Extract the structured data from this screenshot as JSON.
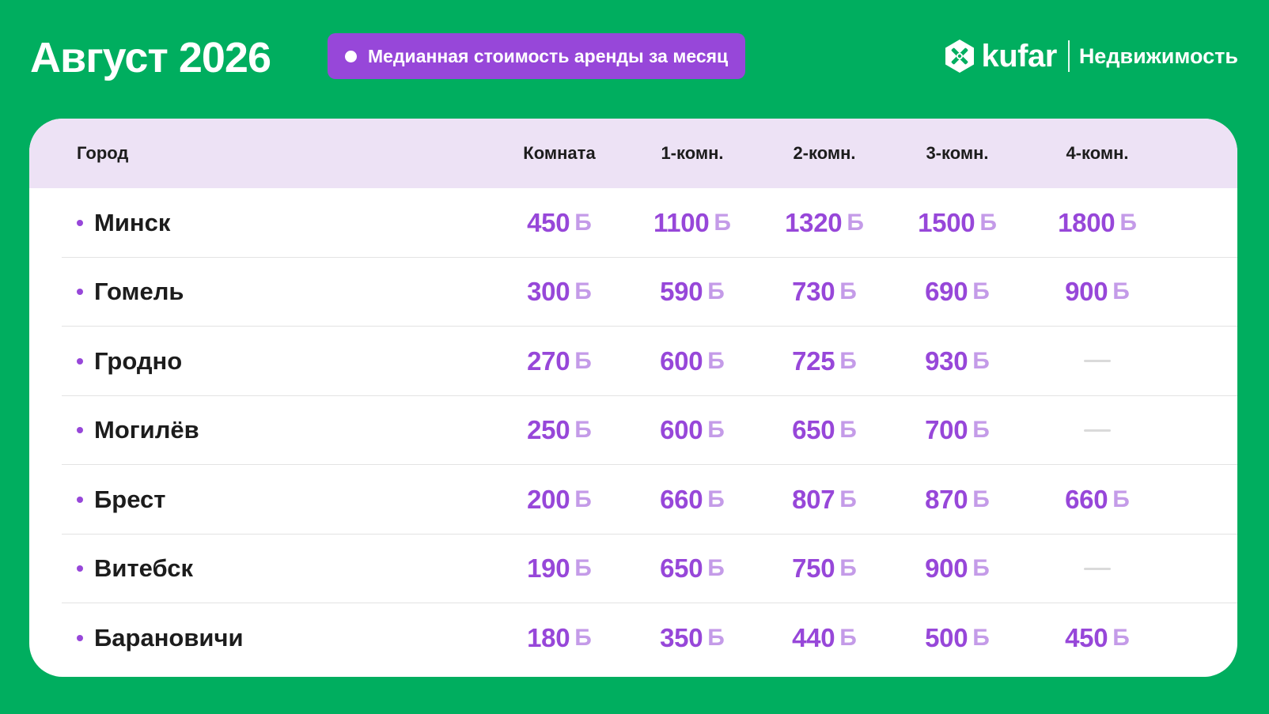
{
  "header": {
    "title": "Август 2026",
    "subtitle": "Медианная стоимость аренды за месяц",
    "brand_name": "kufar",
    "brand_section": "Недвижимость",
    "logo_icon": "kufar-hexagon-logo-icon"
  },
  "colors": {
    "background": "#00AE5F",
    "accent": "#9747D9",
    "accent_light": "#C49BE8",
    "header_row": "#EDE2F5",
    "text": "#1C1C1C"
  },
  "table": {
    "currency": "Б",
    "headers": [
      "Город",
      "Комната",
      "1-комн.",
      "2-комн.",
      "3-комн.",
      "4-комн."
    ],
    "rows": [
      {
        "city": "Минск",
        "values": [
          "450",
          "1100",
          "1320",
          "1500",
          "1800"
        ]
      },
      {
        "city": "Гомель",
        "values": [
          "300",
          "590",
          "730",
          "690",
          "900"
        ]
      },
      {
        "city": "Гродно",
        "values": [
          "270",
          "600",
          "725",
          "930",
          null
        ]
      },
      {
        "city": "Могилёв",
        "values": [
          "250",
          "600",
          "650",
          "700",
          null
        ]
      },
      {
        "city": "Брест",
        "values": [
          "200",
          "660",
          "807",
          "870",
          "660"
        ]
      },
      {
        "city": "Витебск",
        "values": [
          "190",
          "650",
          "750",
          "900",
          null
        ]
      },
      {
        "city": "Барановичи",
        "values": [
          "180",
          "350",
          "440",
          "500",
          "450"
        ]
      }
    ]
  }
}
